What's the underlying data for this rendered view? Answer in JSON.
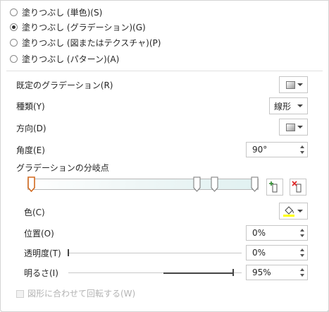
{
  "fill_options": [
    {
      "label": "塗りつぶし (単色)(S)",
      "checked": false
    },
    {
      "label": "塗りつぶし (グラデーション)(G)",
      "checked": true
    },
    {
      "label": "塗りつぶし (図またはテクスチャ)(P)",
      "checked": false
    },
    {
      "label": "塗りつぶし (パターン)(A)",
      "checked": false
    }
  ],
  "preset": {
    "label": "既定のグラデーション(R)"
  },
  "type": {
    "label": "種類(Y)",
    "value": "線形"
  },
  "direction": {
    "label": "方向(D)"
  },
  "angle": {
    "label": "角度(E)",
    "value": "90°"
  },
  "stops": {
    "label": "グラデーションの分岐点",
    "positions_percent": [
      0,
      74,
      82,
      100
    ],
    "selected_index": 0,
    "add_icon": "add-gradient-stop-icon",
    "remove_icon": "remove-gradient-stop-icon"
  },
  "color": {
    "label": "色(C)",
    "icon": "paint-bucket-icon",
    "swatch": "#ffff00"
  },
  "position": {
    "label": "位置(O)",
    "value": "0%"
  },
  "transparency": {
    "label": "透明度(T)",
    "value": "0%",
    "level_percent": 0
  },
  "brightness": {
    "label": "明るさ(I)",
    "value": "95%",
    "level_percent": 95
  },
  "rotate_with_shape": {
    "label": "図形に合わせて回転する(W)",
    "checked": false,
    "enabled": false
  }
}
